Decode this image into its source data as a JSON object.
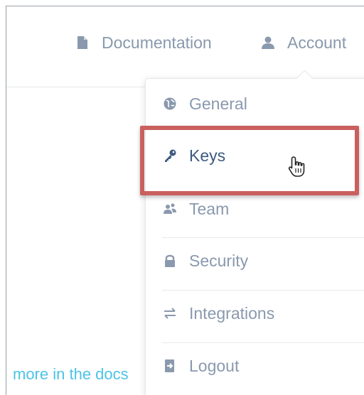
{
  "header": {
    "documentation_label": "Documentation",
    "account_label": "Account"
  },
  "dropdown": {
    "items": [
      {
        "label": "General",
        "icon": "globe-icon"
      },
      {
        "label": "Keys",
        "icon": "key-icon",
        "active": true
      },
      {
        "label": "Team",
        "icon": "team-icon"
      },
      {
        "label": "Security",
        "icon": "lock-icon"
      },
      {
        "label": "Integrations",
        "icon": "swap-arrows-icon"
      },
      {
        "label": "Logout",
        "icon": "logout-icon"
      }
    ]
  },
  "background": {
    "docs_link_text": "more in the docs"
  },
  "colors": {
    "nav_text": "#8a99ad",
    "active_text": "#3d5a80",
    "link": "#4cc3e8",
    "highlight": "#c9605f"
  }
}
